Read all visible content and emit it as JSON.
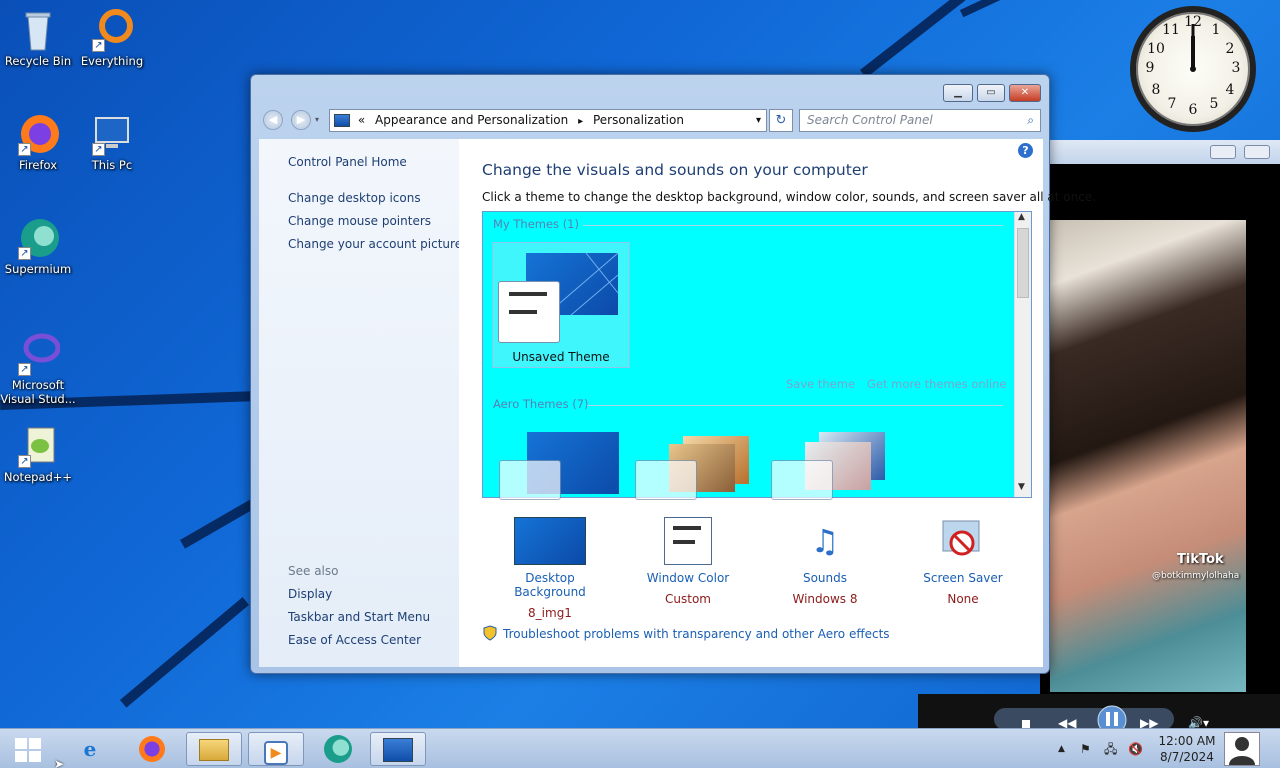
{
  "desktop": {
    "icons": [
      {
        "label": "Recycle Bin",
        "icon": "recycle-bin-icon"
      },
      {
        "label": "Everything",
        "icon": "everything-icon"
      },
      {
        "label": "Firefox",
        "icon": "firefox-icon"
      },
      {
        "label": "This Pc",
        "icon": "this-pc-icon"
      },
      {
        "label": "Supermium",
        "icon": "supermium-icon"
      },
      {
        "label": "Microsoft Visual Stud...",
        "icon": "visual-studio-icon"
      },
      {
        "label": "Notepad++",
        "icon": "notepad-plus-plus-icon"
      }
    ],
    "clock_numbers": [
      "12",
      "1",
      "2",
      "3",
      "4",
      "5",
      "6",
      "7",
      "8",
      "9",
      "10",
      "11"
    ]
  },
  "video": {
    "brand": "TikTok",
    "handle": "@botkimmylolhaha"
  },
  "window": {
    "address": {
      "prefix": "«",
      "crumb1": "Appearance and Personalization",
      "sep": "▸",
      "crumb2": "Personalization"
    },
    "search_placeholder": "Search Control Panel",
    "sidebar": {
      "home": "Control Panel Home",
      "tasks": [
        "Change desktop icons",
        "Change mouse pointers",
        "Change your account picture"
      ],
      "see_also_title": "See also",
      "see_also": [
        "Display",
        "Taskbar and Start Menu",
        "Ease of Access Center"
      ]
    },
    "main": {
      "title": "Change the visuals and sounds on your computer",
      "subtitle": "Click a theme to change the desktop background, window color, sounds, and screen saver all at once.",
      "my_themes": "My Themes (1)",
      "unsaved_theme": "Unsaved Theme",
      "save_theme": "Save theme",
      "get_more": "Get more themes online",
      "aero_themes": "Aero Themes (7)",
      "tiles": [
        {
          "label": "Desktop Background",
          "value": "8_img1"
        },
        {
          "label": "Window Color",
          "value": "Custom"
        },
        {
          "label": "Sounds",
          "value": "Windows 8"
        },
        {
          "label": "Screen Saver",
          "value": "None"
        }
      ],
      "troubleshoot": "Troubleshoot problems with transparency and other Aero effects"
    }
  },
  "taskbar": {
    "time": "12:00 AM",
    "date": "8/7/2024"
  },
  "colors": {
    "desktop": "#1068d6",
    "theme_area": "#00ffff",
    "link": "#1a5fb4",
    "value": "#8c1a1a"
  }
}
